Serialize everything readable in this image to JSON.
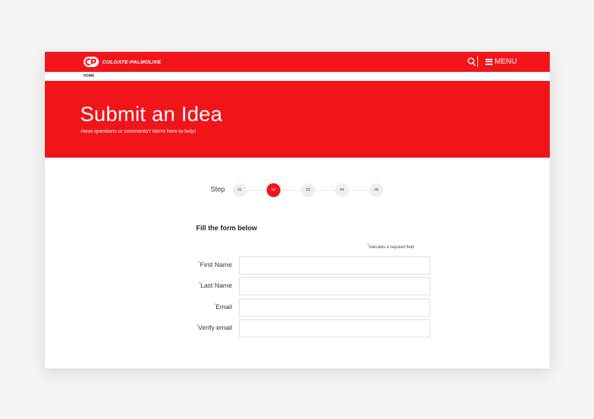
{
  "brand": {
    "name": "COLGATE-PALMOLIVE",
    "primary_color": "#f1151a"
  },
  "header": {
    "search_icon": "search-icon",
    "menu_label": "MENU",
    "menu_icon": "hamburger-icon"
  },
  "breadcrumb": {
    "home": "HOME"
  },
  "hero": {
    "title": "Submit an Idea",
    "subtitle": "Have questions or comments? We're here to help!"
  },
  "steps": {
    "label": "Step",
    "items": [
      {
        "label": "01",
        "active": false
      },
      {
        "label": "02",
        "active": true
      },
      {
        "label": "03",
        "active": false
      },
      {
        "label": "04",
        "active": false
      },
      {
        "label": "05",
        "active": false
      }
    ]
  },
  "form": {
    "title": "Fill the form below",
    "required_marker": "*",
    "required_note": "Indicates a required field",
    "fields": [
      {
        "label": "First Name",
        "value": "",
        "required": true
      },
      {
        "label": "Last Name",
        "value": "",
        "required": true
      },
      {
        "label": "Email",
        "value": "",
        "required": true
      },
      {
        "label": "Verify email",
        "value": "",
        "required": true
      }
    ]
  }
}
